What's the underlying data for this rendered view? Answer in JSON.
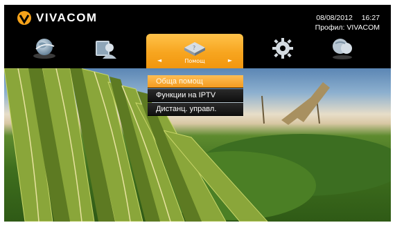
{
  "brand": {
    "name": "VIVACOM",
    "accent": "#F5A21A"
  },
  "status": {
    "date": "08/08/2012",
    "time": "16:27",
    "profile": "Профил: VIVACOM"
  },
  "nav": {
    "items": [
      {
        "icon": "globe-icon"
      },
      {
        "icon": "user-icon"
      },
      {
        "icon": "help-book-icon",
        "label": "Помощ",
        "selected": true
      },
      {
        "icon": "gear-icon"
      },
      {
        "icon": "chat-globe-icon"
      }
    ],
    "arrows": {
      "left": "◄",
      "right": "►"
    }
  },
  "menu": {
    "items": [
      {
        "label": "Обща помощ",
        "selected": true
      },
      {
        "label": "Функции на IPTV",
        "selected": false
      },
      {
        "label": "Дистанц. управл.",
        "selected": false
      }
    ]
  }
}
